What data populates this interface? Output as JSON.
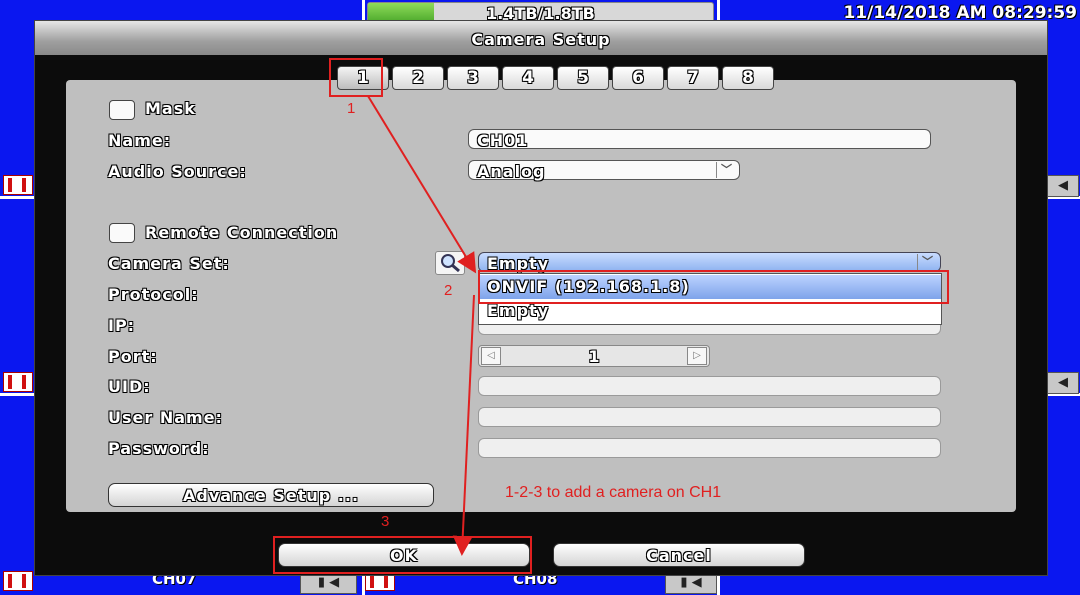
{
  "status": {
    "storage": "1.4TB/1.8TB",
    "storage_used_fraction": 0.19,
    "datetime": "11/14/2018 AM 08:29:59"
  },
  "channels": {
    "ch7": "CH07",
    "ch8": "CH08"
  },
  "dialog": {
    "title": "Camera Setup",
    "tabs": [
      "1",
      "2",
      "3",
      "4",
      "5",
      "6",
      "7",
      "8"
    ],
    "active_tab": "1",
    "mask_label": "Mask",
    "name_label": "Name:",
    "name_value": "CH01",
    "audio_label": "Audio Source:",
    "audio_value": "Analog",
    "remote_label": "Remote Connection",
    "camera_set_label": "Camera Set:",
    "camera_set_value": "Empty",
    "camera_set_options": [
      "ONVIF (192.168.1.8)",
      "Empty"
    ],
    "protocol_label": "Protocol:",
    "ip_label": "IP:",
    "port_label": "Port:",
    "port_value": "1",
    "uid_label": "UID:",
    "username_label": "User Name:",
    "password_label": "Password:",
    "advance_label": "Advance Setup ...",
    "ok_label": "OK",
    "cancel_label": "Cancel"
  },
  "annotations": {
    "step1": "1",
    "step2": "2",
    "step3": "3",
    "note": "1-2-3 to add a camera on CH1",
    "color": "#e02020"
  },
  "colors": {
    "background": "#0a17f0",
    "panel": "#bfbfbf",
    "selected": "#8fb3f0"
  }
}
